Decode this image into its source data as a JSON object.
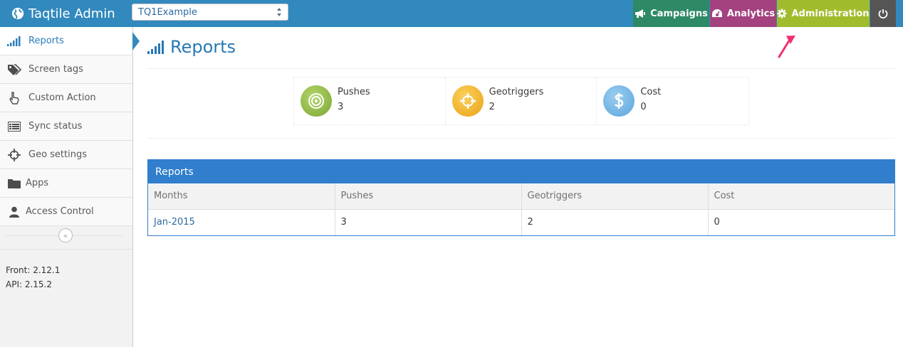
{
  "app": {
    "title": "Taqtile Admin"
  },
  "app_select": {
    "value": "TQ1Example"
  },
  "nav": {
    "campaigns": "Campaigns",
    "analytics": "Analytics",
    "administration": "Administration"
  },
  "sidebar": {
    "items": [
      {
        "label": "Reports",
        "icon": "signal-icon"
      },
      {
        "label": "Screen tags",
        "icon": "tags-icon"
      },
      {
        "label": "Custom Action",
        "icon": "pointer-hand-icon"
      },
      {
        "label": "Sync status",
        "icon": "list-icon"
      },
      {
        "label": "Geo settings",
        "icon": "crosshairs-icon"
      },
      {
        "label": "Apps",
        "icon": "folder-icon"
      },
      {
        "label": "Access Control",
        "icon": "user-icon"
      }
    ],
    "versions": {
      "front": "Front: 2.12.1",
      "api": "API: 2.15.2"
    }
  },
  "main": {
    "title": "Reports",
    "stats": [
      {
        "label": "Pushes",
        "value": "3",
        "color": "#8bb83f"
      },
      {
        "label": "Geotriggers",
        "value": "2",
        "color": "#f0b424"
      },
      {
        "label": "Cost",
        "value": "0",
        "color": "#6fb3e0"
      }
    ],
    "table": {
      "title": "Reports",
      "columns": [
        "Months",
        "Pushes",
        "Geotriggers",
        "Cost"
      ],
      "rows": [
        [
          "Jan-2015",
          "3",
          "2",
          "0"
        ]
      ]
    }
  },
  "colors": {
    "navbar": "#3189bd",
    "campaigns": "#2e8965",
    "analytics": "#a3427e",
    "administration": "#a0bc2d",
    "annotation_arrow": "#f2306e"
  }
}
